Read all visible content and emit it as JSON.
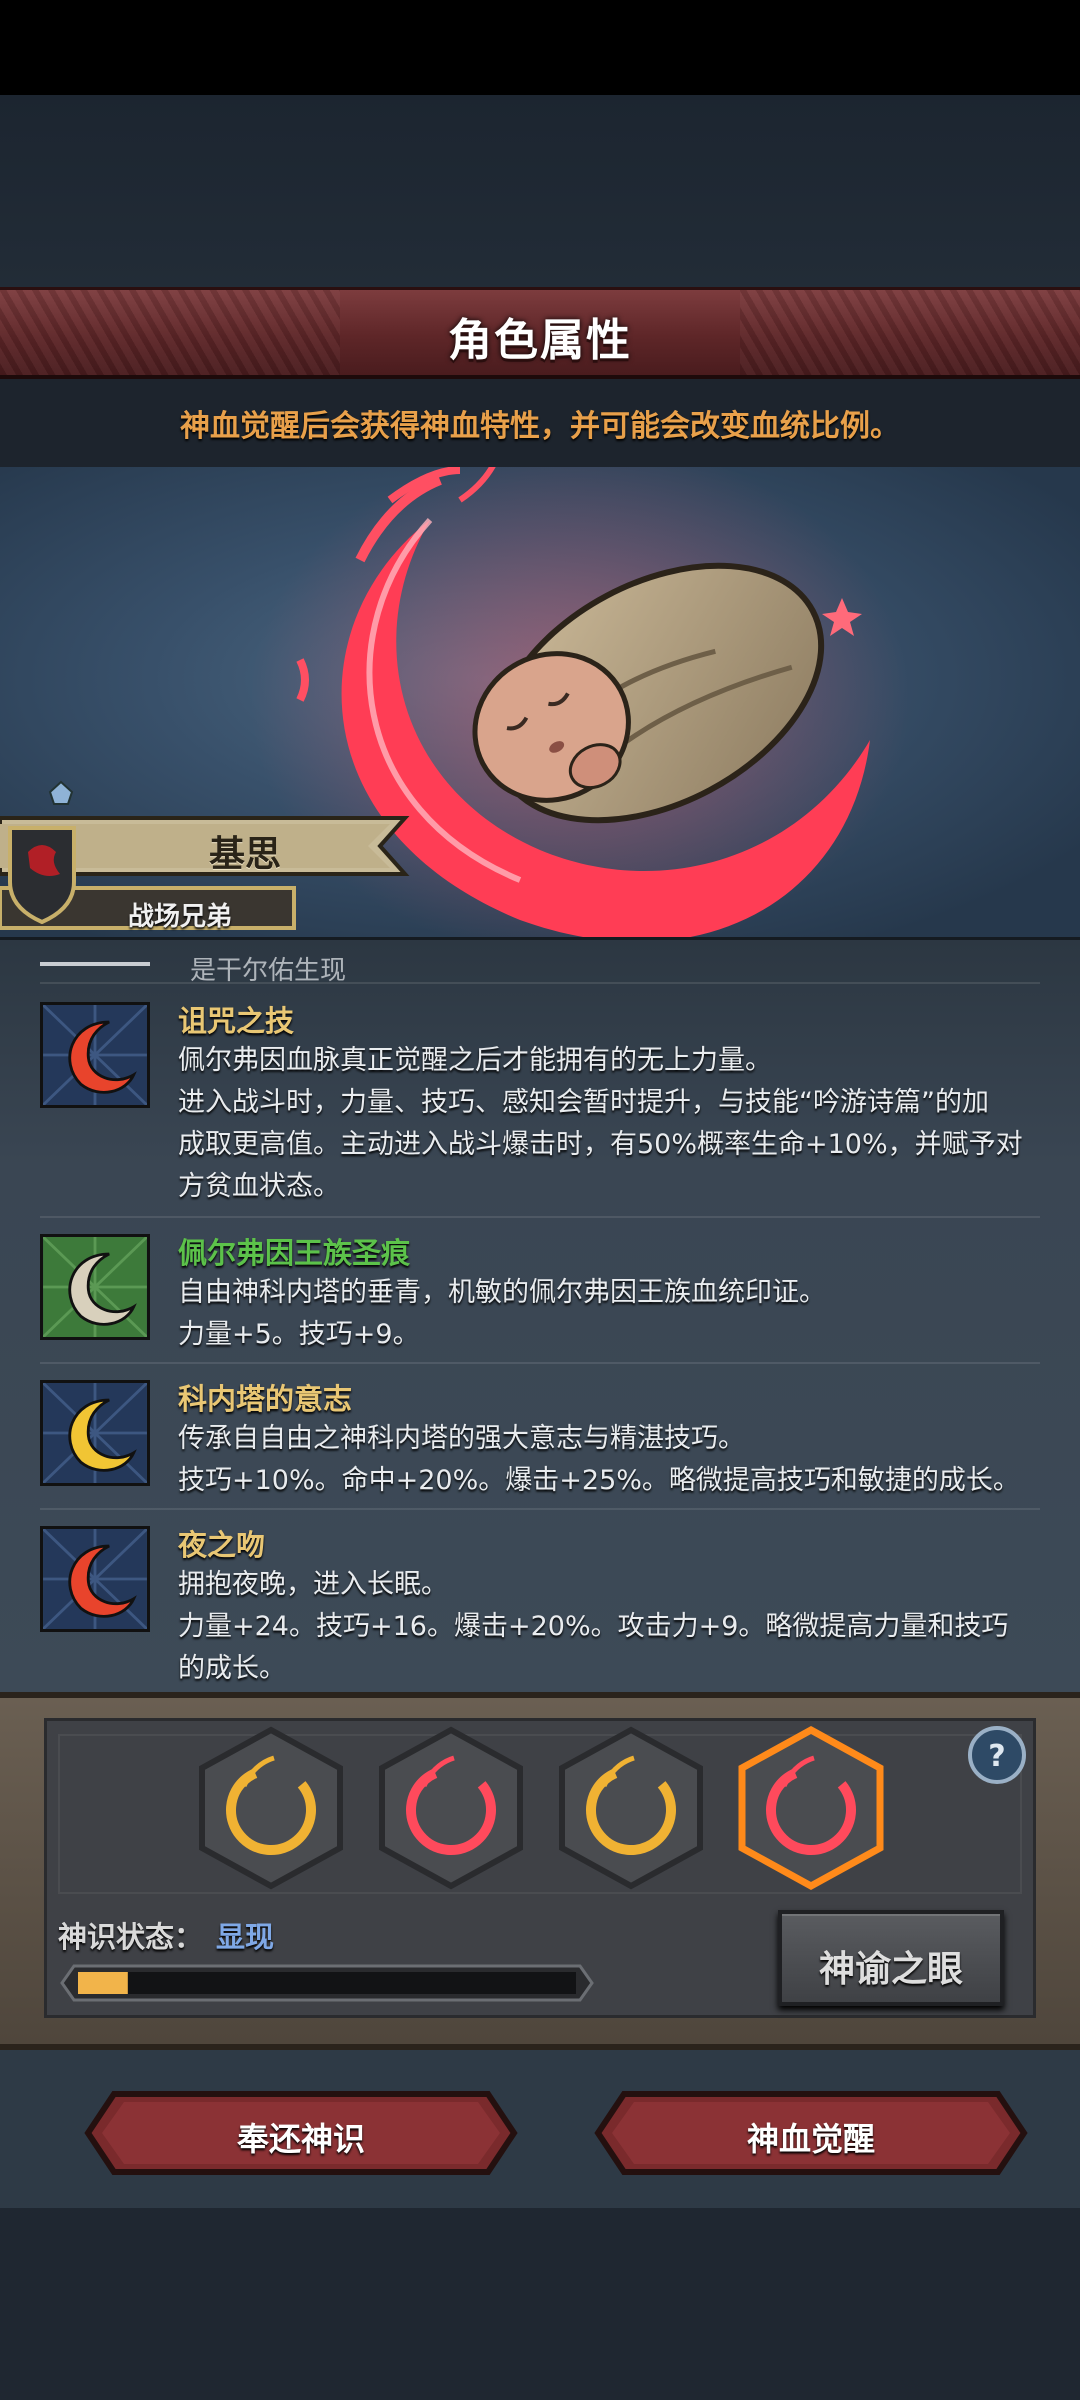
{
  "header": {
    "title": "角色属性",
    "notice": "神血觉醒后会获得神血特性，并可能会改变血统比例。"
  },
  "character": {
    "name": "基思",
    "subtitle": "战场兄弟"
  },
  "traits_cut_text": "是干尔佑生现",
  "traits": [
    {
      "name": "诅咒之技",
      "name_color": "#e9c774",
      "icon": "red-crescent-icon",
      "lines": [
        "佩尔弗因血脉真正觉醒之后才能拥有的无上力量。",
        "进入战斗时，力量、技巧、感知会暂时提升，与技能“吟游诗篇”的加",
        "成取更高值。主动进入战斗爆击时，有50%概率生命+10%，并赋予对",
        "方贫血状态。"
      ]
    },
    {
      "name": "佩尔弗因王族圣痕",
      "name_color": "#5cc24a",
      "icon": "white-crescent-icon",
      "lines": [
        "自由神科内塔的垂青，机敏的佩尔弗因王族血统印证。",
        "力量+5。技巧+9。"
      ]
    },
    {
      "name": "科内塔的意志",
      "name_color": "#e9c774",
      "icon": "yellow-crescent-icon",
      "lines": [
        "传承自自由之神科内塔的强大意志与精湛技巧。",
        "技巧+10%。命中+20%。爆击+25%。略微提高技巧和敏捷的成长。"
      ]
    },
    {
      "name": "夜之吻",
      "name_color": "#e9c774",
      "icon": "red-crescent-icon",
      "lines": [
        "拥抱夜晚，进入长眠。",
        "力量+24。技巧+16。爆击+20%。攻击力+9。略微提高力量和技巧",
        "的成长。"
      ]
    }
  ],
  "runes": [
    {
      "color": "gold",
      "selected": false
    },
    {
      "color": "red",
      "selected": false
    },
    {
      "color": "gold",
      "selected": false
    },
    {
      "color": "red",
      "selected": true
    }
  ],
  "status": {
    "label": "神识状态：",
    "value": "显现",
    "progress": 0.1
  },
  "buttons": {
    "oracle": "神谕之眼",
    "return": "奉还神识",
    "awaken": "神血觉醒",
    "help": "?"
  }
}
